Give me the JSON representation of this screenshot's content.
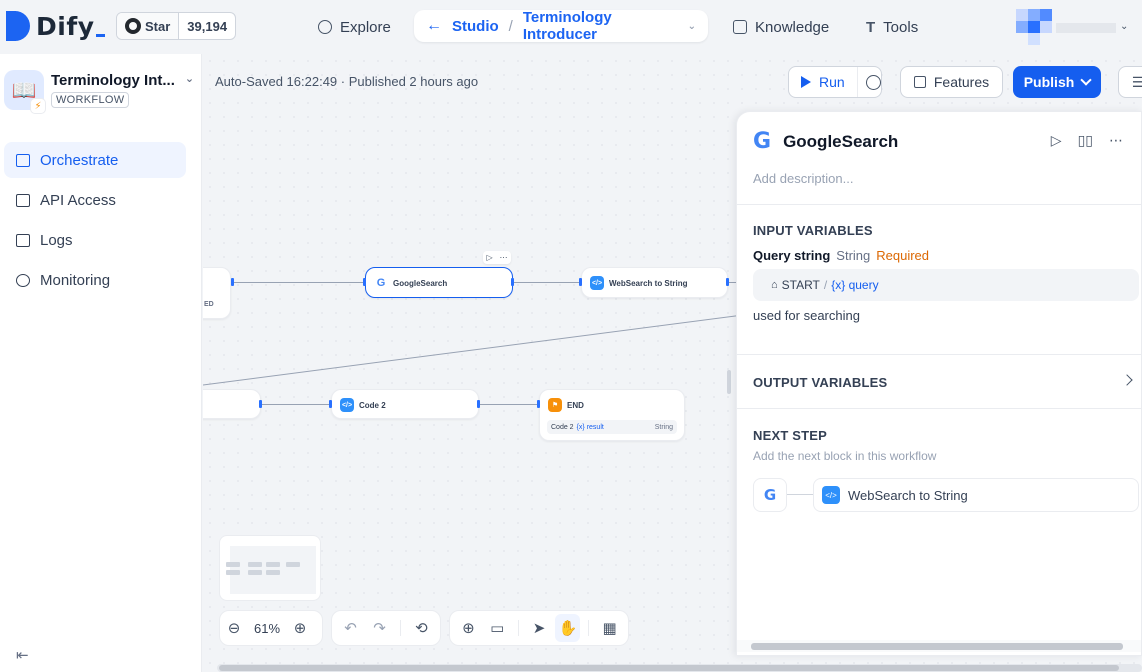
{
  "brand": {
    "name": "Dify",
    "accent": "#1c64f2"
  },
  "github": {
    "star_label": "Star",
    "star_count": "39,194"
  },
  "nav": {
    "explore": "Explore",
    "studio": "Studio",
    "app_name": "Terminology Introducer",
    "knowledge": "Knowledge",
    "tools": "Tools"
  },
  "sidebar": {
    "app_title": "Terminology Int...",
    "app_type": "WORKFLOW",
    "items": [
      {
        "label": "Orchestrate",
        "icon": "layout-icon",
        "active": true
      },
      {
        "label": "API Access",
        "icon": "terminal-icon",
        "active": false
      },
      {
        "label": "Logs",
        "icon": "file-list-icon",
        "active": false
      },
      {
        "label": "Monitoring",
        "icon": "gauge-icon",
        "active": false
      }
    ]
  },
  "toolbar": {
    "save_info": "Auto-Saved 16:22:49 · Published 2 hours ago",
    "run_label": "Run",
    "features_label": "Features",
    "publish_label": "Publish"
  },
  "canvas": {
    "nodes": [
      {
        "label": "GoogleSearch"
      },
      {
        "label": "WebSearch to String"
      },
      {
        "label": "Code 2"
      },
      {
        "label": "END"
      }
    ],
    "end_output": {
      "source": "Code 2",
      "var": "{x} result",
      "type": "String"
    },
    "left_fragment": "ED"
  },
  "zoom": {
    "level": "61%"
  },
  "panel": {
    "title": "GoogleSearch",
    "description_placeholder": "Add description...",
    "input_title": "INPUT VARIABLES",
    "input_var": {
      "name": "Query string",
      "type": "String",
      "required": "Required",
      "source_node": "START",
      "source_var": "{x} query",
      "description": "used for searching"
    },
    "output_title": "OUTPUT VARIABLES",
    "next_title": "NEXT STEP",
    "next_subtitle": "Add the next block in this workflow",
    "next_block": "WebSearch to String"
  }
}
